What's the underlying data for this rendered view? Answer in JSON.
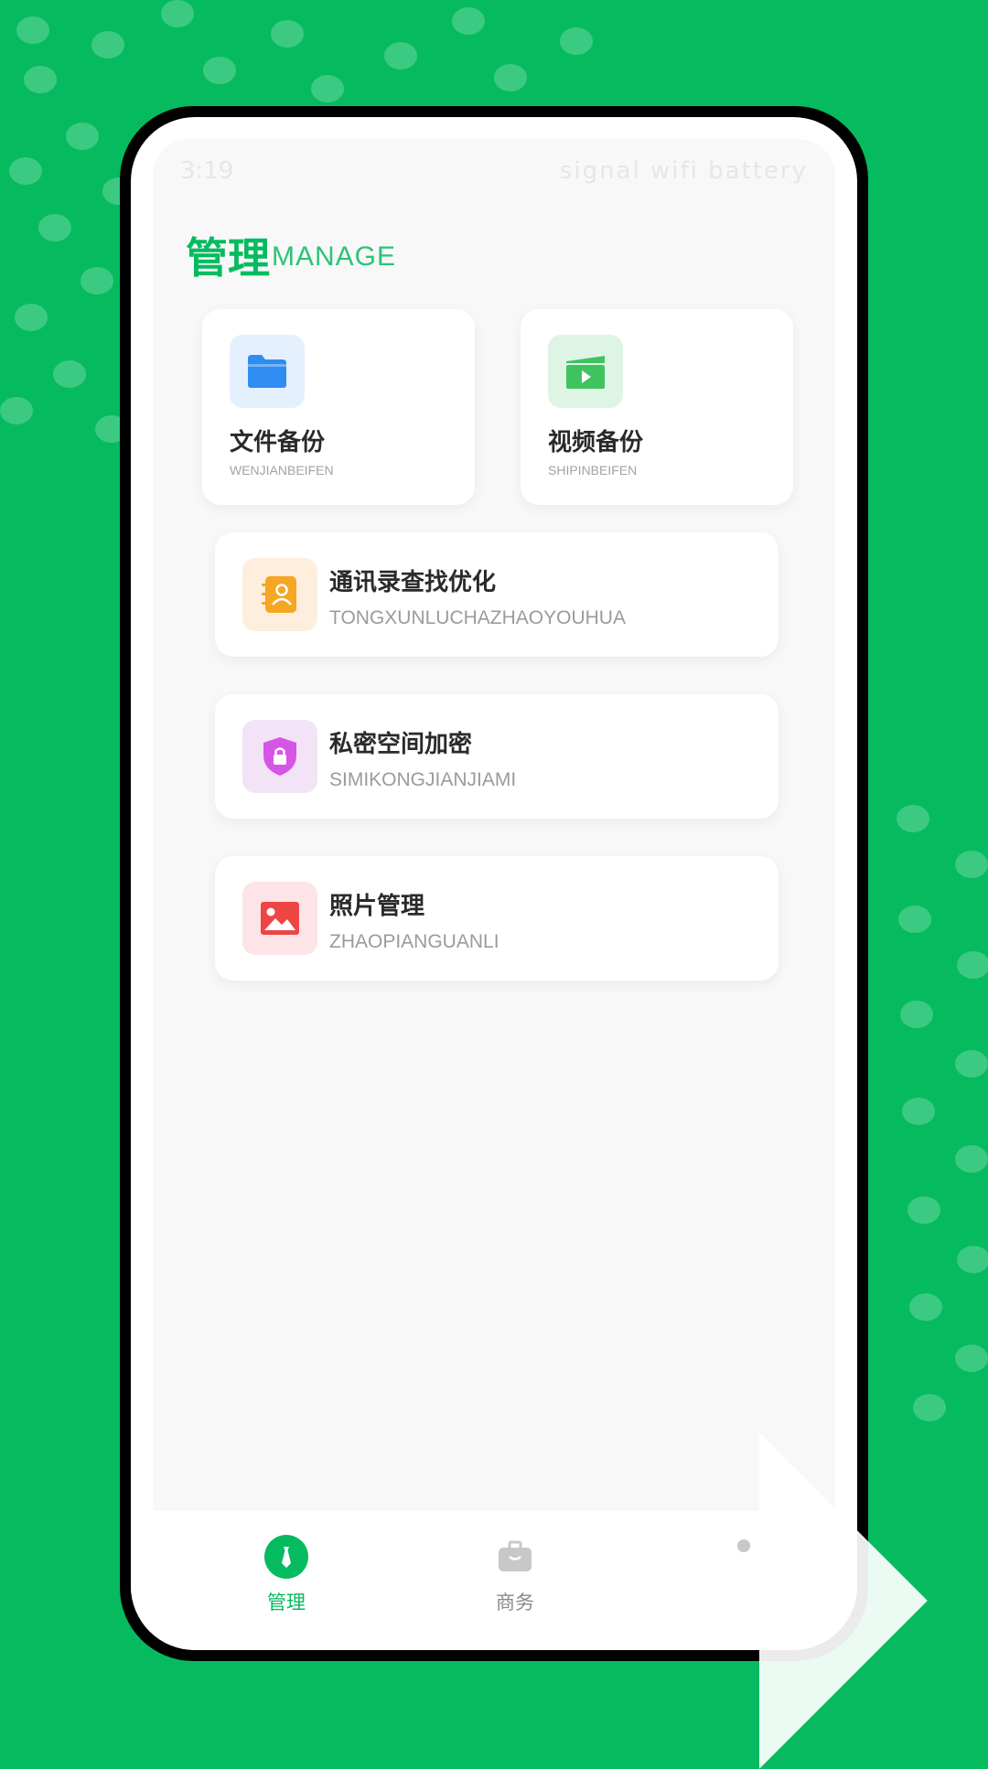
{
  "statusbar": {
    "time": "3:19",
    "indicators": "signal wifi battery"
  },
  "header": {
    "title_cn": "管理",
    "title_en": "MANAGE"
  },
  "cards_top": [
    {
      "title": "文件备份",
      "subtitle": "WENJIANBEIFEN",
      "icon": "folder-icon",
      "icon_bg": "#e5f0ff",
      "icon_color": "#2f8cf0"
    },
    {
      "title": "视频备份",
      "subtitle": "SHIPINBEIFEN",
      "icon": "video-clapper-icon",
      "icon_bg": "#def5e6",
      "icon_color": "#3fc35f"
    }
  ],
  "cards_wide": [
    {
      "title": "通讯录查找优化",
      "subtitle": "TONGXUNLUCHAZHAOYOUHUA",
      "icon": "contacts-book-icon",
      "icon_bg": "#fdeede",
      "icon_color": "#f5a623"
    },
    {
      "title": "私密空间加密",
      "subtitle": "SIMIKONGJIANJIAMI",
      "icon": "shield-lock-icon",
      "icon_bg": "#f2e3f7",
      "icon_color": "#d654e6"
    },
    {
      "title": "照片管理",
      "subtitle": "ZHAOPIANGUANLI",
      "icon": "image-icon",
      "icon_bg": "#fde4e6",
      "icon_color": "#ee4545"
    }
  ],
  "tabbar": {
    "items": [
      {
        "label": "管理",
        "active": true,
        "icon": "tie-icon"
      },
      {
        "label": "商务",
        "active": false,
        "icon": "briefcase-icon"
      },
      {
        "label": "",
        "active": false,
        "icon": "user-icon"
      }
    ]
  },
  "colors": {
    "brand": "#06bb5f",
    "active_tab": "#06bb5f",
    "inactive_tab": "#8a8a8a"
  }
}
